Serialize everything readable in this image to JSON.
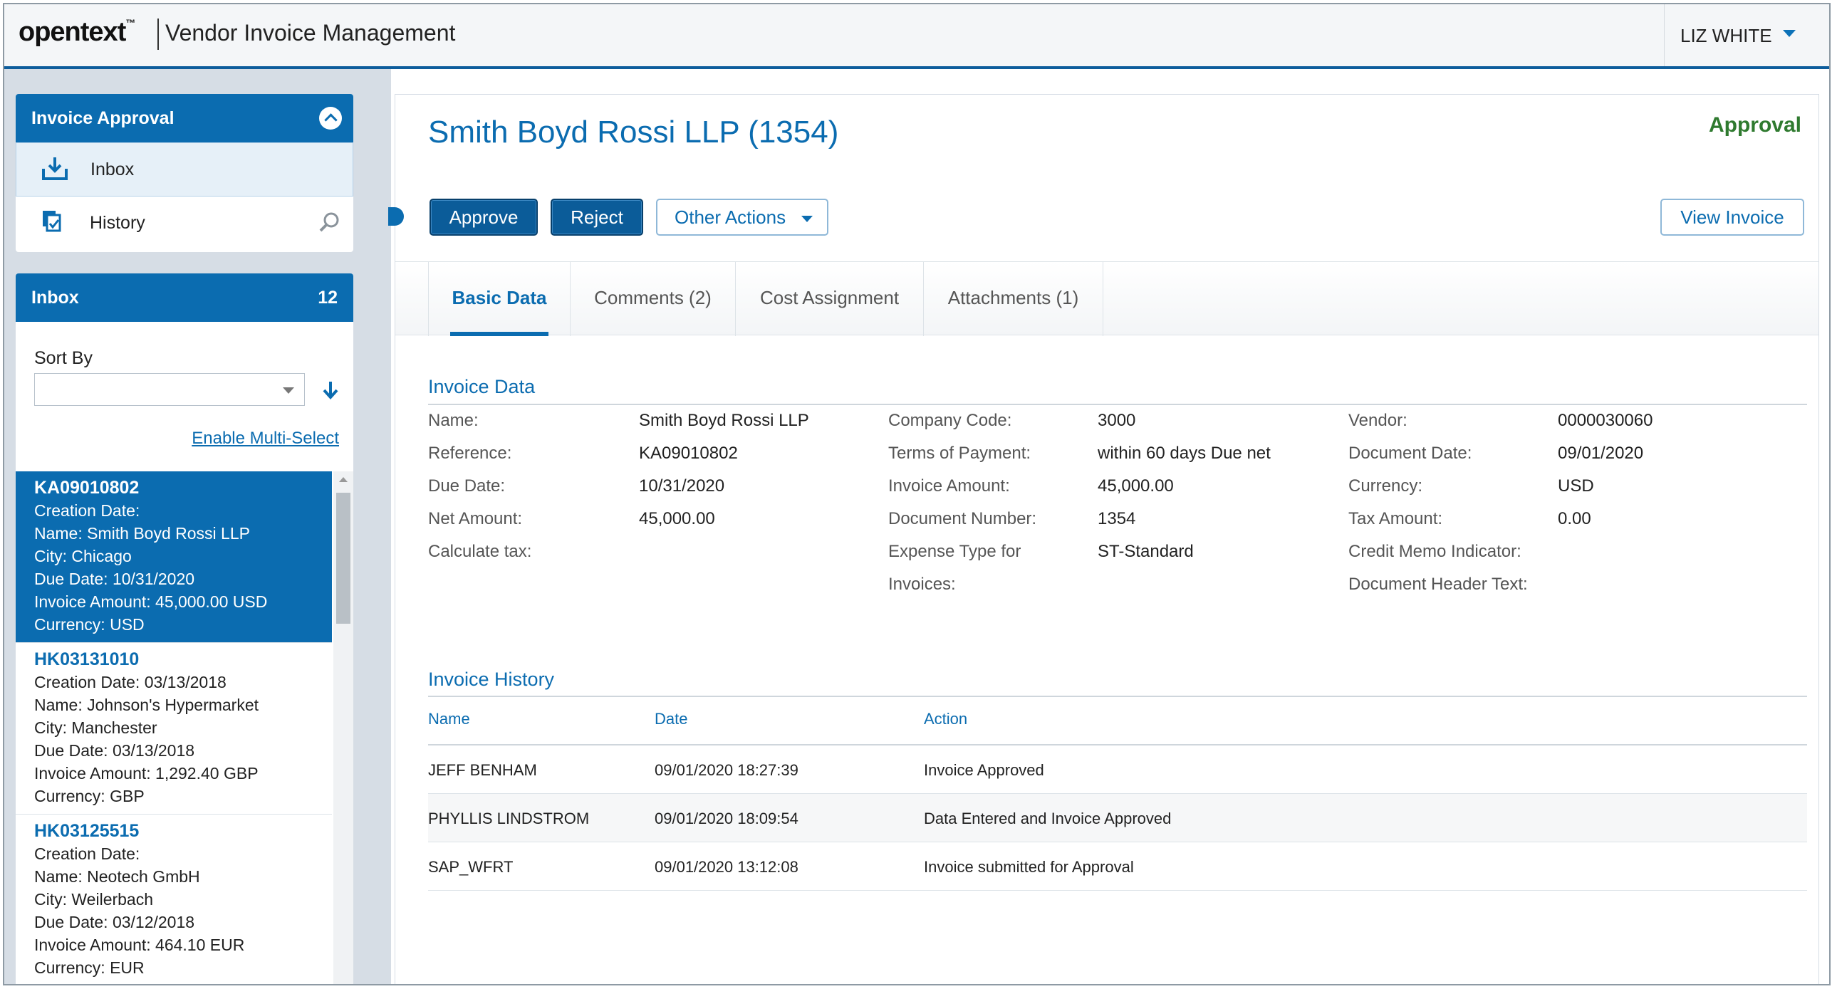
{
  "header": {
    "logo": "opentext",
    "logo_tm": "™",
    "app_title": "Vendor Invoice Management",
    "user_name": "LIZ WHITE"
  },
  "nav": {
    "title": "Invoice Approval",
    "items": [
      {
        "label": "Inbox"
      },
      {
        "label": "History"
      }
    ]
  },
  "inbox": {
    "title": "Inbox",
    "count": "12",
    "sort_label": "Sort By",
    "sort_value": "",
    "multi_select": "Enable Multi-Select",
    "items": [
      {
        "id": "KA09010802",
        "lines": [
          "Creation Date:",
          "Name: Smith Boyd Rossi LLP",
          "City: Chicago",
          "Due Date: 10/31/2020",
          "Invoice Amount: 45,000.00 USD",
          "Currency: USD"
        ]
      },
      {
        "id": "HK03131010",
        "lines": [
          "Creation Date: 03/13/2018",
          "Name: Johnson's Hypermarket",
          "City: Manchester",
          "Due Date: 03/13/2018",
          "Invoice Amount: 1,292.40 GBP",
          "Currency: GBP"
        ]
      },
      {
        "id": "HK03125515",
        "lines": [
          "Creation Date:",
          "Name: Neotech GmbH",
          "City: Weilerbach",
          "Due Date: 03/12/2018",
          "Invoice Amount: 464.10 EUR",
          "Currency: EUR"
        ]
      }
    ]
  },
  "main": {
    "title": "Smith Boyd Rossi LLP (1354)",
    "status": "Approval",
    "buttons": {
      "approve": "Approve",
      "reject": "Reject",
      "other": "Other Actions",
      "view": "View Invoice"
    },
    "tabs": [
      "Basic Data",
      "Comments (2)",
      "Cost Assignment",
      "Attachments (1)"
    ],
    "invoice_data": {
      "title": "Invoice Data",
      "col1": [
        {
          "label": "Name:",
          "value": "Smith Boyd Rossi LLP"
        },
        {
          "label": "Reference:",
          "value": "KA09010802"
        },
        {
          "label": "Due Date:",
          "value": "10/31/2020"
        },
        {
          "label": "Net Amount:",
          "value": "45,000.00"
        },
        {
          "label": "Calculate tax:",
          "value": ""
        }
      ],
      "col2": [
        {
          "label": "Company Code:",
          "value": "3000"
        },
        {
          "label": "Terms of Payment:",
          "value": "within 60 days Due net"
        },
        {
          "label": "Invoice Amount:",
          "value": "45,000.00"
        },
        {
          "label": "Document Number:",
          "value": "1354"
        },
        {
          "label": "Expense Type for",
          "label2": "Invoices:",
          "value": "ST-Standard"
        }
      ],
      "col3": [
        {
          "label": "Vendor:",
          "value": "0000030060"
        },
        {
          "label": "Document Date:",
          "value": "09/01/2020"
        },
        {
          "label": "Currency:",
          "value": "USD"
        },
        {
          "label": "Tax Amount:",
          "value": "0.00"
        },
        {
          "label": "Credit Memo Indicator:",
          "value": ""
        },
        {
          "label": "Document Header Text:",
          "value": ""
        }
      ]
    },
    "history": {
      "title": "Invoice History",
      "columns": [
        "Name",
        "Date",
        "Action"
      ],
      "rows": [
        {
          "name": "JEFF BENHAM",
          "date": "09/01/2020 18:27:39",
          "action": "Invoice Approved"
        },
        {
          "name": "PHYLLIS LINDSTROM",
          "date": "09/01/2020 18:09:54",
          "action": "Data Entered and Invoice Approved"
        },
        {
          "name": "SAP_WFRT",
          "date": "09/01/2020 13:12:08",
          "action": "Invoice submitted for Approval"
        }
      ]
    }
  },
  "colors": {
    "brand_blue": "#0b6cb0",
    "status_green": "#2f7a2f"
  }
}
